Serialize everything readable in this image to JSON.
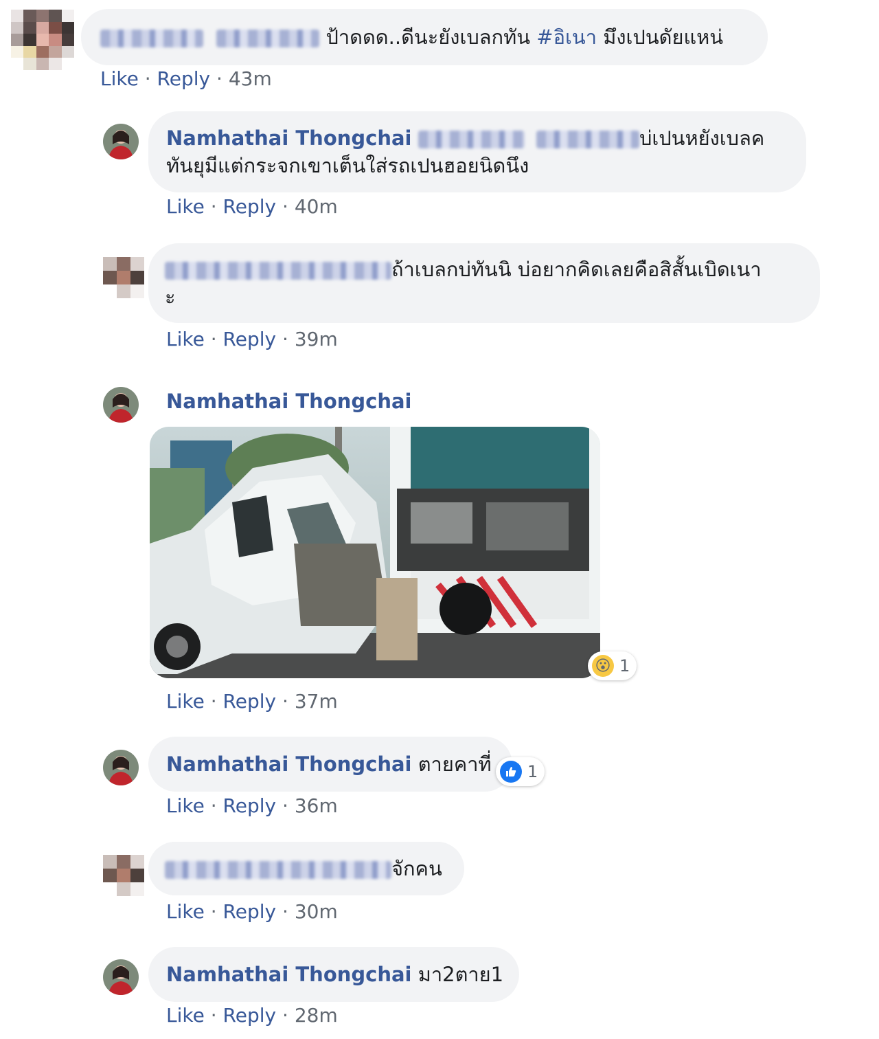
{
  "comments": [
    {
      "author_blurred": true,
      "text_before": "ป้าดดด..ดีนะยังเบลกทัน ",
      "hashtag": "#อิเนา",
      "text_after": " มึงเปนดัยแหน่",
      "like": "Like",
      "reply": "Reply",
      "time": "43m"
    }
  ],
  "replies": [
    {
      "author": "Namhathai Thongchai",
      "line1": "บ่เปนหยังเบลค",
      "line2": "ทันยุมีแต่กระจกเขาเต็นใส่รถเปนฮอยนิดนึง",
      "like": "Like",
      "reply": "Reply",
      "time": "40m"
    },
    {
      "line1": "ถ้าเบลกบ่ทันนิ บ่อยากคิดเลยคือสิสั้นเบิดเนา",
      "line2": "ะ",
      "like": "Like",
      "reply": "Reply",
      "time": "39m"
    },
    {
      "author": "Namhathai Thongchai",
      "reaction": {
        "icon": "wow-icon",
        "emoji": "😮",
        "count": "1"
      },
      "like": "Like",
      "reply": "Reply",
      "time": "37m"
    },
    {
      "author": "Namhathai Thongchai",
      "text": " ตายคาที่",
      "reaction": {
        "icon": "like-reaction-icon",
        "count": "1"
      },
      "like": "Like",
      "reply": "Reply",
      "time": "36m"
    },
    {
      "text": "จักคน",
      "like": "Like",
      "reply": "Reply",
      "time": "30m"
    },
    {
      "author": "Namhathai Thongchai",
      "text": " มา2ตาย1",
      "like": "Like",
      "reply": "Reply",
      "time": "28m"
    }
  ],
  "colors": {
    "link": "#385898",
    "bubble": "#f2f3f5",
    "meta": "#606770",
    "like_blue": "#1877f2"
  }
}
